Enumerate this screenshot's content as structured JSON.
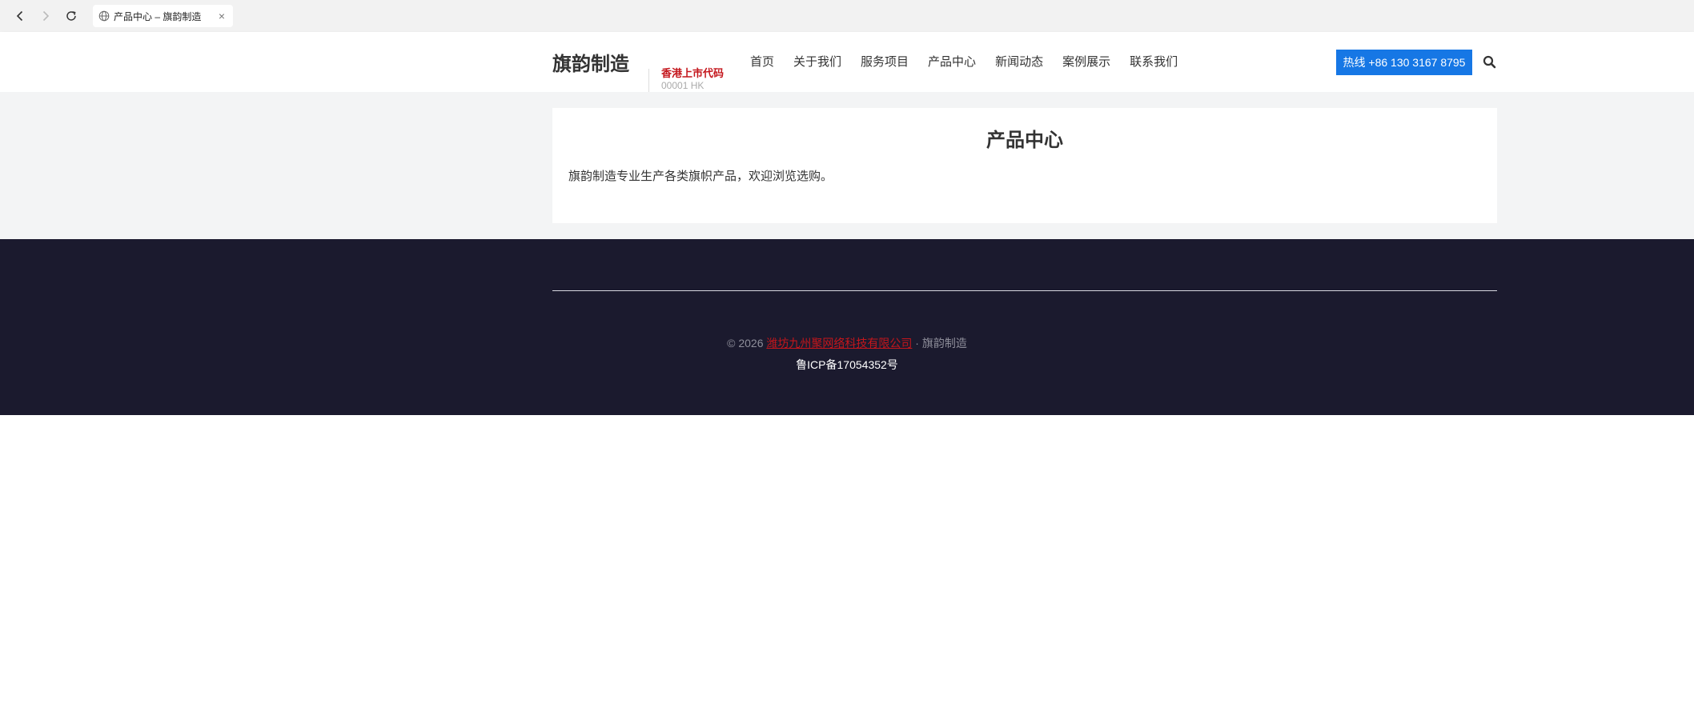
{
  "browser": {
    "tab_title": "产品中心 – 旗韵制造",
    "close_glyph": "×"
  },
  "header": {
    "logo": "旗韵制造",
    "stock_label": "香港上市代码",
    "stock_code": "00001 HK",
    "nav": [
      "首页",
      "关于我们",
      "服务项目",
      "产品中心",
      "新闻动态",
      "案例展示",
      "联系我们"
    ],
    "hotline": "热线 +86 130 3167 8795"
  },
  "main": {
    "title": "产品中心",
    "description": "旗韵制造专业生产各类旗帜产品，欢迎浏览选购。"
  },
  "footer": {
    "copyright_prefix": "© 2026 ",
    "company_link": "潍坊九州聚网络科技有限公司",
    "copyright_suffix": " · 旗韵制造",
    "icp": "鲁ICP备17054352号"
  },
  "colors": {
    "accent_red": "#c4161c",
    "hotline_blue": "#1677e5",
    "footer_bg": "#1b1a2e"
  }
}
